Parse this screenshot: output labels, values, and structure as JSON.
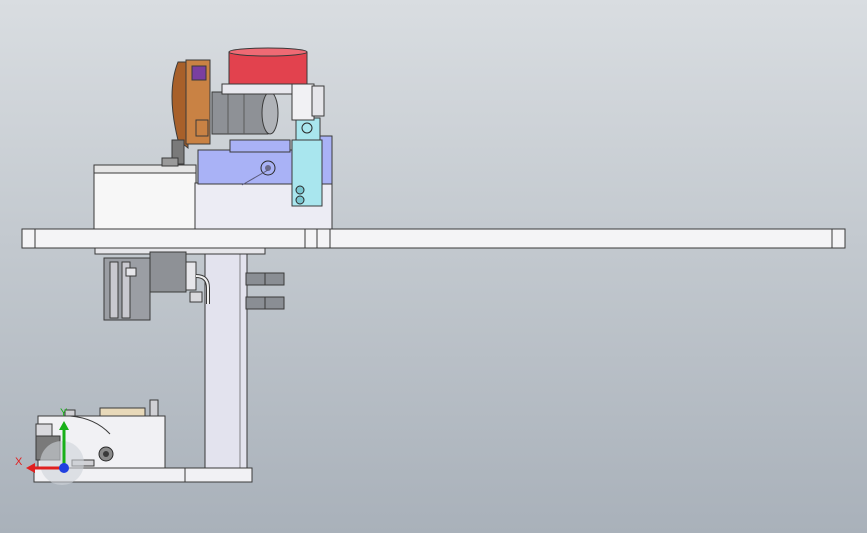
{
  "view": {
    "background_top": "#d9dde1",
    "background_bottom": "#a9b1ba"
  },
  "triad": {
    "x_label": "X",
    "y_label": "Y",
    "x_color": "#e02020",
    "y_color": "#18b018",
    "z_color": "#2040e0"
  },
  "colors": {
    "edge": "#3a3a3a",
    "plate": "#f4f4f6",
    "upright": "#e3e3ee",
    "cover_white": "#f7f7f7",
    "flange_red": "#e2424e",
    "motor_gray": "#8e9196",
    "bracket_blue": "#a9b2f6",
    "clamp_cyan": "#a9e6ee",
    "bracket_brown": "#a8602a",
    "fitting_gray": "#8a8e94",
    "base_block": "#f1f1f4"
  }
}
